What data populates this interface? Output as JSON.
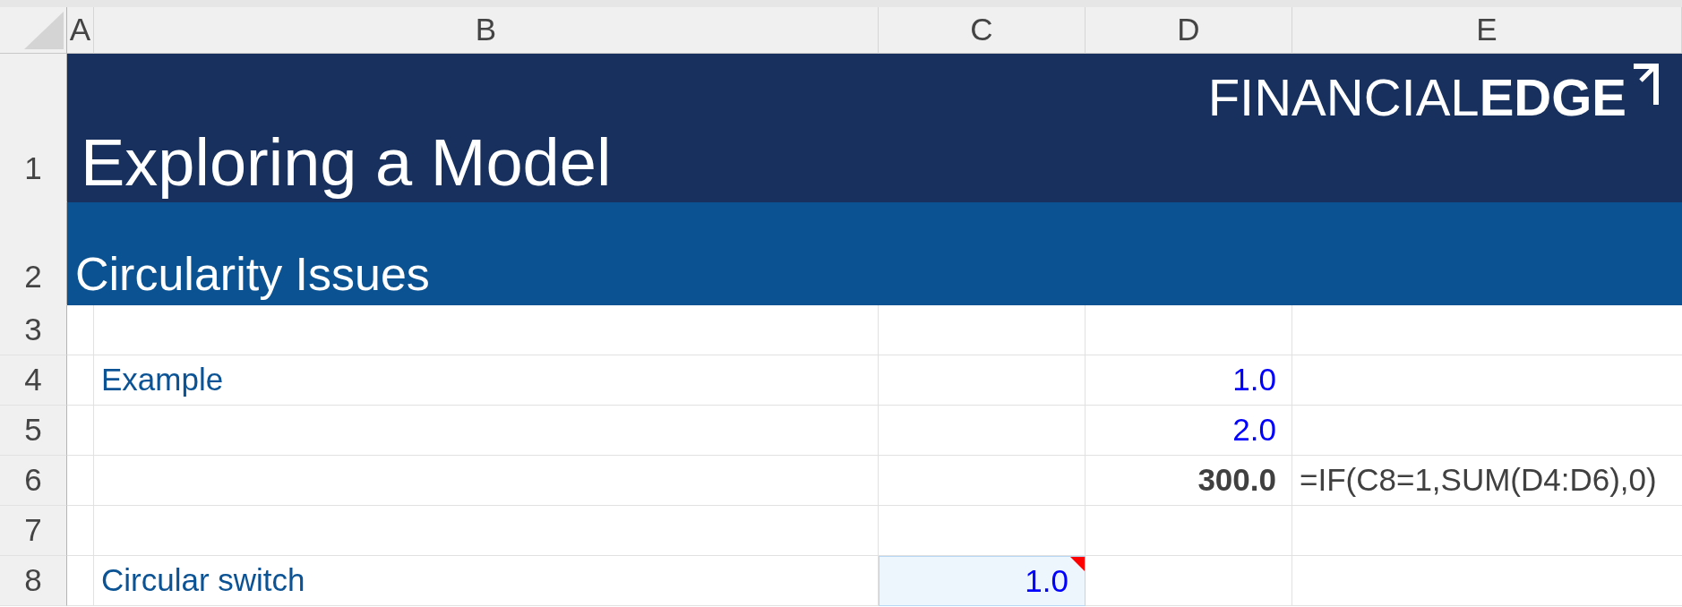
{
  "column_headers": [
    "A",
    "B",
    "C",
    "D",
    "E"
  ],
  "title_row": {
    "row_number": "1",
    "title": "Exploring a Model",
    "logo": "FINANCIAL**EDGE**"
  },
  "section_row": {
    "row_number": "2",
    "heading": "Circularity Issues"
  },
  "rows": [
    {
      "row_number": "3"
    },
    {
      "row_number": "4",
      "cells": {
        "b": {
          "kind": "label",
          "text": "Example",
          "comment": false
        },
        "d": {
          "kind": "input",
          "text": "1.0",
          "comment": false
        }
      }
    },
    {
      "row_number": "5",
      "cells": {
        "d": {
          "kind": "input",
          "text": "2.0",
          "comment": false
        }
      }
    },
    {
      "row_number": "6",
      "cells": {
        "d": {
          "kind": "calculation",
          "text": "300.0",
          "comment": false
        },
        "e": {
          "kind": "formula",
          "text": "=IF(C8=1,SUM(D4:D6),0)",
          "comment": false
        }
      }
    },
    {
      "row_number": "7"
    },
    {
      "row_number": "8",
      "cells": {
        "b": {
          "kind": "label",
          "text": "Circular switch",
          "comment": false
        },
        "c": {
          "kind": "switch",
          "text": "1.0",
          "comment": true
        }
      }
    }
  ]
}
